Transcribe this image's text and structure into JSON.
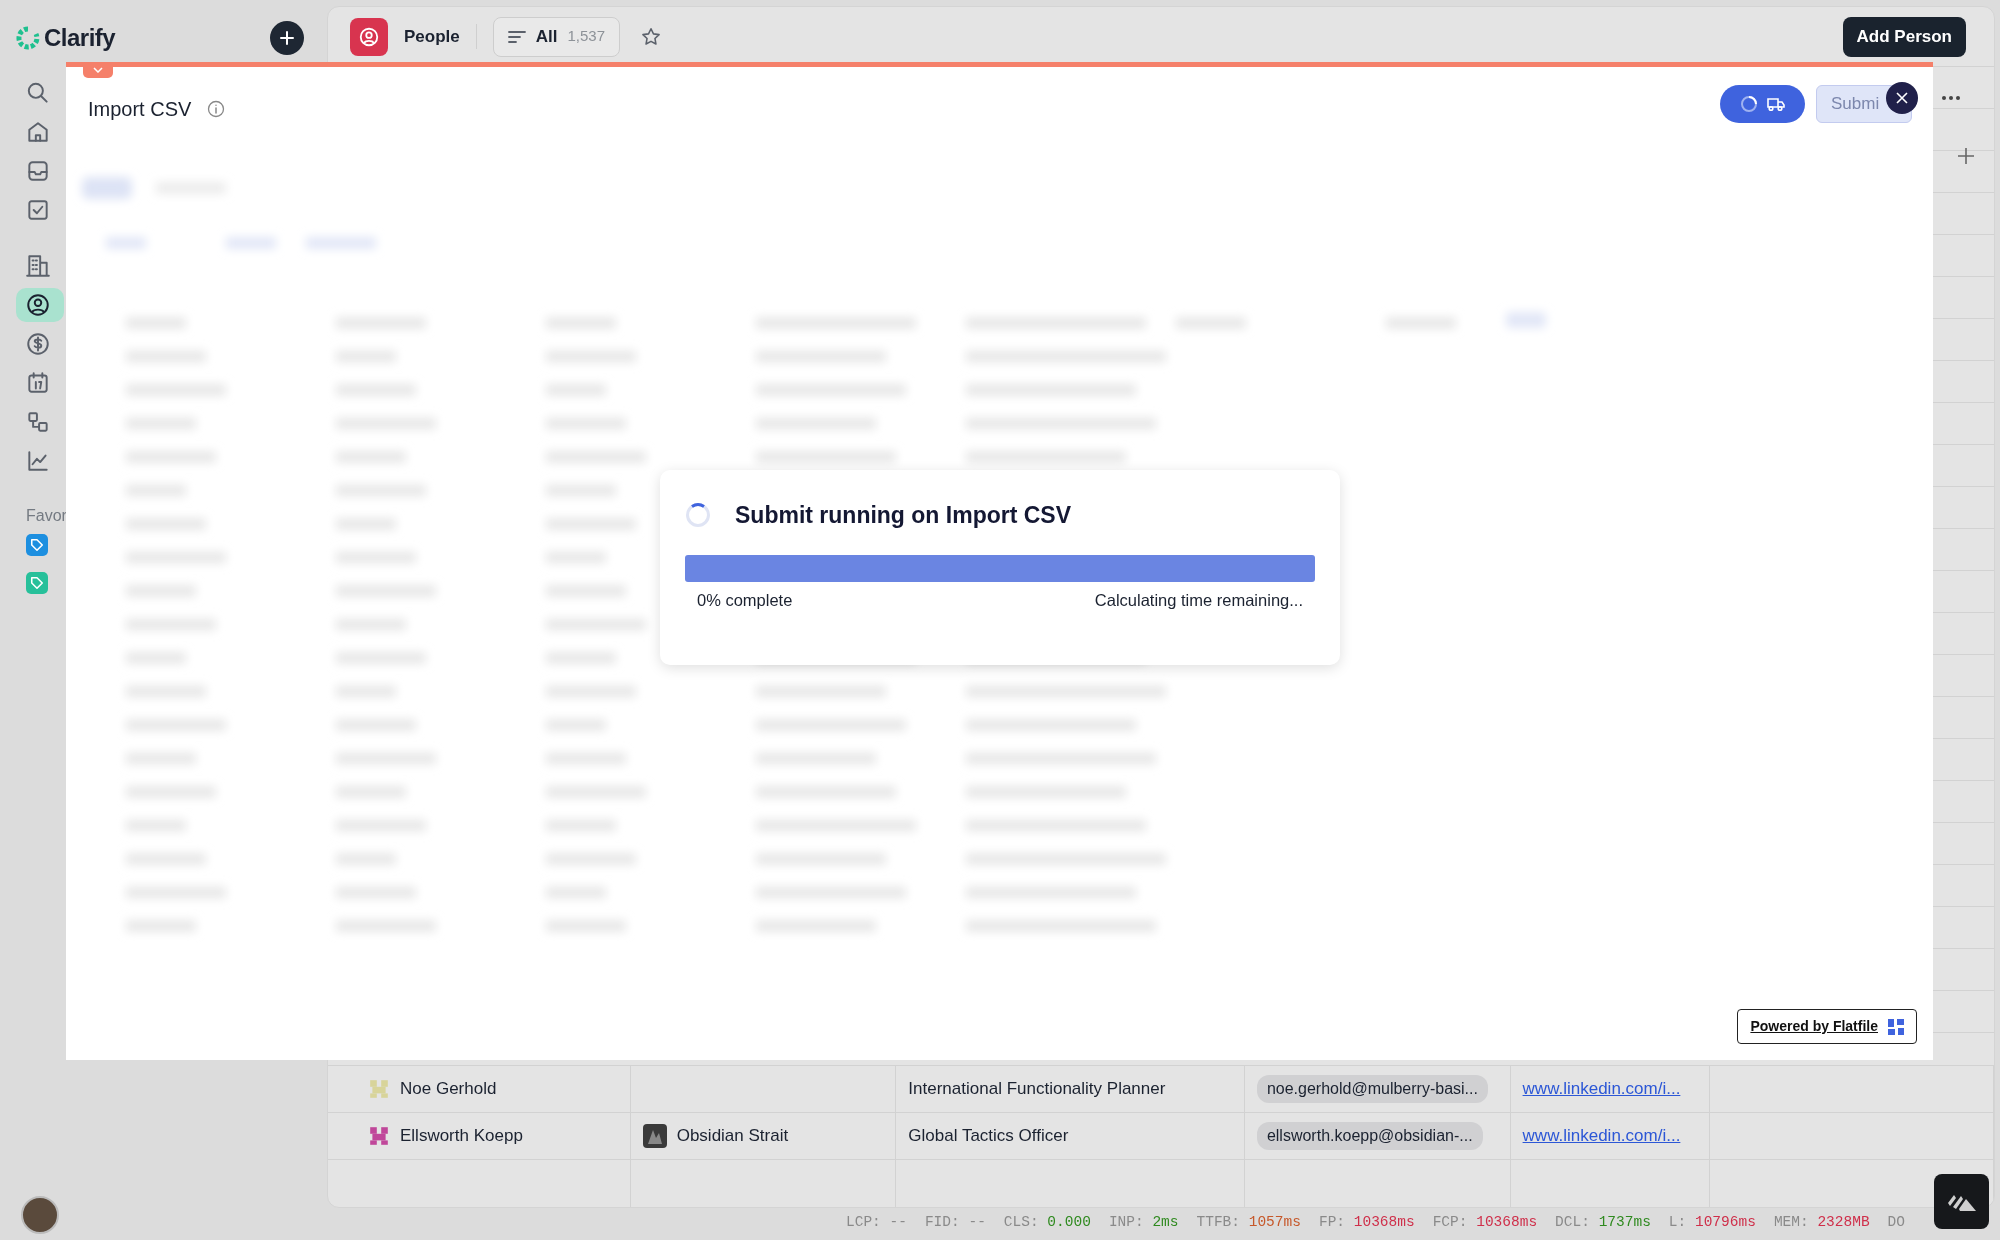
{
  "app": {
    "logo": "Clarify"
  },
  "sidebar": {
    "sections": [
      {
        "items": [
          {
            "kind": "search",
            "selected": false
          },
          {
            "kind": "home",
            "selected": false
          },
          {
            "kind": "inbox",
            "selected": false
          },
          {
            "kind": "tasks",
            "selected": false
          }
        ]
      },
      {
        "items": [
          {
            "kind": "building",
            "selected": false
          },
          {
            "kind": "person",
            "selected": true
          },
          {
            "kind": "dollar",
            "selected": false
          },
          {
            "kind": "calendar",
            "selected": false
          },
          {
            "kind": "workflow",
            "selected": false
          },
          {
            "kind": "chart",
            "selected": false
          }
        ]
      }
    ],
    "favorites_label": "Favor",
    "favorites": [
      {
        "color": "#1d8fe0"
      },
      {
        "color": "#27c09a"
      }
    ]
  },
  "header": {
    "object": "People",
    "view": {
      "label": "All",
      "count": "1,537"
    },
    "add_button": "Add Person"
  },
  "import_modal": {
    "title": "Import CSV",
    "submit": {
      "label": "Submi",
      "disabled": true
    },
    "progress": {
      "title": "Submit running on Import CSV",
      "level": 0,
      "percent_text": "0% complete",
      "time_text": "Calculating time remaining..."
    },
    "powered_by": "Powered by Flatfile"
  },
  "table": {
    "rows": [
      {
        "name": "Noe Gerhold",
        "color": "#d8d49a",
        "title": "International Functionality Planner",
        "email": "noe.gerhold@mulberry-basi...",
        "link": "www.linkedin.com/i..."
      },
      {
        "name": "Ellsworth Koepp",
        "color": "#c0479a",
        "company": "Obsidian Strait",
        "title": "Global Tactics Officer",
        "email": "ellsworth.koepp@obsidian-...",
        "link": "www.linkedin.com/i..."
      }
    ]
  },
  "status_bar": {
    "metrics": [
      {
        "label": "LCP:",
        "value": "--",
        "color": "#8a8a8a"
      },
      {
        "label": "FID:",
        "value": "--",
        "color": "#8a8a8a"
      },
      {
        "label": "CLS:",
        "value": "0.000",
        "color": "#2f8a1f"
      },
      {
        "label": "INP:",
        "value": "2ms",
        "color": "#2f8a1f"
      },
      {
        "label": "TTFB:",
        "value": "1057ms",
        "color": "#c6582a"
      },
      {
        "label": "FP:",
        "value": "10368ms",
        "color": "#cf2f4a"
      },
      {
        "label": "FCP:",
        "value": "10368ms",
        "color": "#cf2f4a"
      },
      {
        "label": "DCL:",
        "value": "1737ms",
        "color": "#2f8a1f"
      },
      {
        "label": "L:",
        "value": "10796ms",
        "color": "#cf2f4a"
      },
      {
        "label": "MEM:",
        "value": "2328MB",
        "color": "#cf2f4a"
      }
    ],
    "tail": "DO"
  }
}
